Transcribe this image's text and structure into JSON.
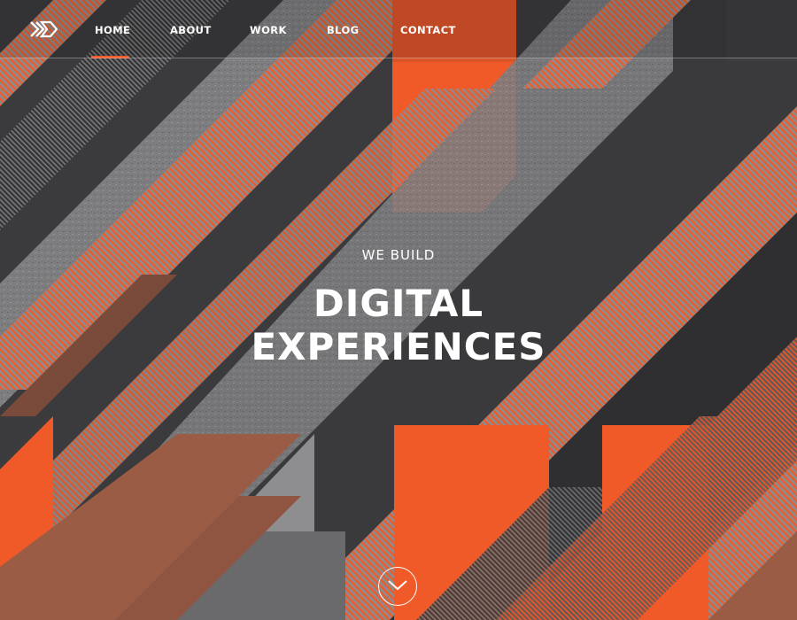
{
  "brand": {
    "logo_icon": "arrow-logo-icon"
  },
  "nav": {
    "items": [
      {
        "label": "HOME",
        "active": true
      },
      {
        "label": "ABOUT",
        "active": false
      },
      {
        "label": "WORK",
        "active": false
      },
      {
        "label": "BLOG",
        "active": false
      },
      {
        "label": "CONTACT",
        "active": false
      }
    ]
  },
  "hero": {
    "kicker": "WE BUILD",
    "title_line_1": "DIGITAL",
    "title_line_2": "EXPERIENCES"
  },
  "scroll": {
    "icon": "chevron-down-icon"
  },
  "colors": {
    "accent": "#f05a28",
    "dark": "#3b3b3d",
    "gray": "#8a8a8c",
    "rust": "#9a5c44",
    "text": "#ffffff"
  }
}
